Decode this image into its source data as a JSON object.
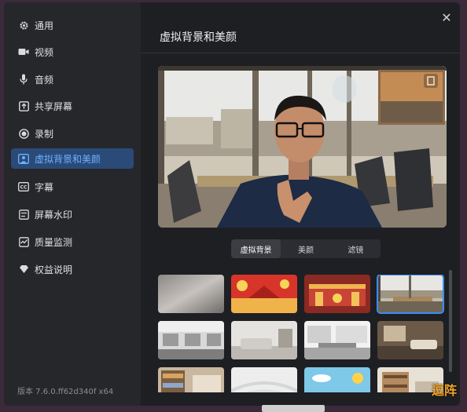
{
  "sidebar": {
    "items": [
      {
        "label": "通用",
        "icon": "gear-icon"
      },
      {
        "label": "视频",
        "icon": "video-camera-icon"
      },
      {
        "label": "音频",
        "icon": "microphone-icon"
      },
      {
        "label": "共享屏幕",
        "icon": "share-screen-icon"
      },
      {
        "label": "录制",
        "icon": "record-icon"
      },
      {
        "label": "虚拟背景和美颜",
        "icon": "virtual-background-icon",
        "active": true
      },
      {
        "label": "字幕",
        "icon": "subtitles-icon"
      },
      {
        "label": "屏幕水印",
        "icon": "watermark-icon"
      },
      {
        "label": "质量监测",
        "icon": "quality-monitor-icon"
      },
      {
        "label": "权益说明",
        "icon": "diamond-icon"
      }
    ],
    "version": "版本 7.6.0.ff62d340f x64"
  },
  "main": {
    "title": "虚拟背景和美颜",
    "close_icon": "close-icon",
    "tabs": [
      {
        "label": "虚拟背景",
        "active": true
      },
      {
        "label": "美颜"
      },
      {
        "label": "滤镜"
      }
    ],
    "backgrounds": [
      {
        "name": "blur",
        "selected": false
      },
      {
        "name": "festive-red-1",
        "selected": false
      },
      {
        "name": "festive-red-2",
        "selected": false
      },
      {
        "name": "office-window",
        "selected": true
      },
      {
        "name": "office-1",
        "selected": false
      },
      {
        "name": "living-room-1",
        "selected": false
      },
      {
        "name": "office-2",
        "selected": false
      },
      {
        "name": "living-room-2",
        "selected": false
      },
      {
        "name": "bookshelf",
        "selected": false
      },
      {
        "name": "white-minimal",
        "selected": false
      },
      {
        "name": "sky-cartoon",
        "selected": false
      },
      {
        "name": "shelf-room",
        "selected": false
      }
    ]
  },
  "colors": {
    "accent": "#3a8ef0",
    "active_bg": "#2a4a78",
    "active_text": "#6fb1ff"
  },
  "watermark": "逗阵"
}
